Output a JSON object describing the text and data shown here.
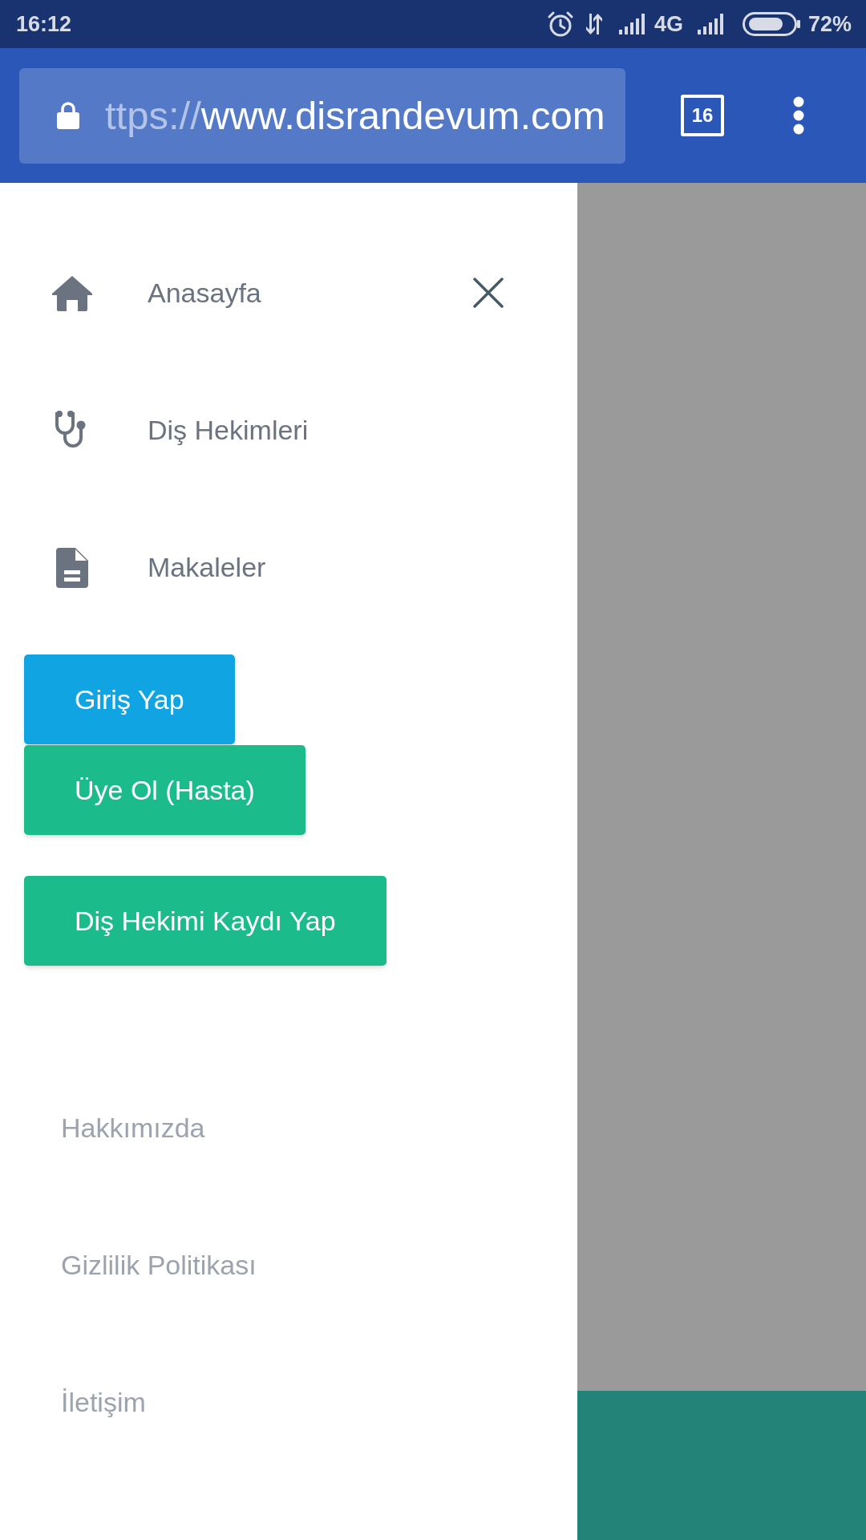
{
  "status_bar": {
    "time": "16:12",
    "network": "4G",
    "battery": "72%"
  },
  "browser_toolbar": {
    "url_scheme": "ttps://",
    "url_host": "www.disrandevum.com",
    "tab_count": "16"
  },
  "drawer": {
    "nav_items": [
      {
        "label": "Anasayfa"
      },
      {
        "label": "Diş Hekimleri"
      },
      {
        "label": "Makaleler"
      }
    ],
    "buttons": [
      {
        "label": "Giriş Yap",
        "color": "#10a5e2"
      },
      {
        "label": "Üye Ol (Hasta)",
        "color": "#1bbb8c"
      },
      {
        "label": "Diş Hekimi Kaydı Yap",
        "color": "#1bbb8c"
      }
    ],
    "footer_links": [
      {
        "label": "Hakkımızda"
      },
      {
        "label": "Gizlilik Politikası"
      },
      {
        "label": "İletişim"
      }
    ]
  }
}
